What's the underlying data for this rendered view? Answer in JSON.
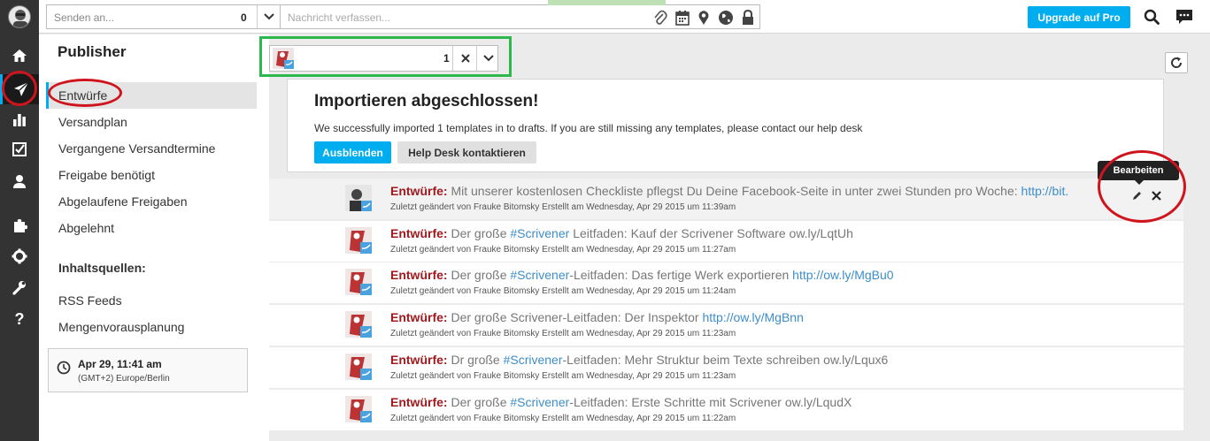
{
  "topbar": {
    "send_to_placeholder": "Senden an...",
    "send_to_count": "0",
    "compose_placeholder": "Nachricht verfassen...",
    "upgrade_label": "Upgrade auf Pro",
    "accent_color": "#00aeef"
  },
  "rail": {
    "icons": [
      "home-icon",
      "paper-plane-icon",
      "bar-chart-icon",
      "checkbox-icon",
      "user-icon",
      "puzzle-icon",
      "gear-icon",
      "wrench-icon",
      "help-icon"
    ],
    "help_glyph": "?"
  },
  "publisher": {
    "title": "Publisher",
    "nav": [
      "Entwürfe",
      "Versandplan",
      "Vergangene Versandtermine",
      "Freigabe benötigt",
      "Abgelaufene Freigaben",
      "Abgelehnt"
    ],
    "sources_heading": "Inhaltsquellen:",
    "sources": [
      "RSS Feeds",
      "Mengenvorausplanung"
    ],
    "clock_time": "Apr 29, 11:41 am",
    "clock_zone": "(GMT+2) Europe/Berlin"
  },
  "account_selector": {
    "count": "1"
  },
  "import_notice": {
    "title": "Importieren abgeschlossen!",
    "message": "We successfully imported 1 templates in to drafts. If you are still missing any templates, please contact our help desk",
    "hide_label": "Ausblenden",
    "help_label": "Help Desk kontaktieren"
  },
  "tooltip": "Bearbeiten",
  "drafts": [
    {
      "label": "Entwürfe:",
      "pre": "Mit unserer kostenlosen Checkliste pflegst Du Deine Facebook-Seite in unter zwei Stunden pro Woche:",
      "hl": "http://bit.",
      "post": "",
      "meta": "Zuletzt geändert von Frauke Bitomsky Erstellt am Wednesday, Apr 29 2015 um 11:39am"
    },
    {
      "label": "Entwürfe:",
      "pre": "Der große",
      "hl": "#Scrivener",
      "post": "Leitfaden: Kauf der Scrivener Software ow.ly/LqtUh",
      "meta": "Zuletzt geändert von Frauke Bitomsky Erstellt am Wednesday, Apr 29 2015 um 11:27am"
    },
    {
      "label": "Entwürfe:",
      "pre": "Der große",
      "hl": "#Scrivener",
      "post": "-Leitfaden: Das fertige Werk exportieren",
      "hl2": "http://ow.ly/MgBu0",
      "meta": "Zuletzt geändert von Frauke Bitomsky Erstellt am Wednesday, Apr 29 2015 um 11:24am"
    },
    {
      "label": "Entwürfe:",
      "pre": "Der große Scrivener-Leitfaden: Der Inspektor",
      "hl": "http://ow.ly/MgBnn",
      "post": "",
      "meta": "Zuletzt geändert von Frauke Bitomsky Erstellt am Wednesday, Apr 29 2015 um 11:23am"
    },
    {
      "label": "Entwürfe:",
      "pre": "Dr große",
      "hl": "#Scrivener",
      "post": "-Leitfaden: Mehr Struktur beim Texte schreiben ow.ly/Lqux6",
      "meta": "Zuletzt geändert von Frauke Bitomsky Erstellt am Wednesday, Apr 29 2015 um 11:23am"
    },
    {
      "label": "Entwürfe:",
      "pre": "Der große",
      "hl": "#Scrivener",
      "post": "-Leitfaden: Erste Schritte mit Scrivener ow.ly/LqudX",
      "meta": "Zuletzt geändert von Frauke Bitomsky Erstellt am Wednesday, Apr 29 2015 um 11:22am"
    }
  ]
}
